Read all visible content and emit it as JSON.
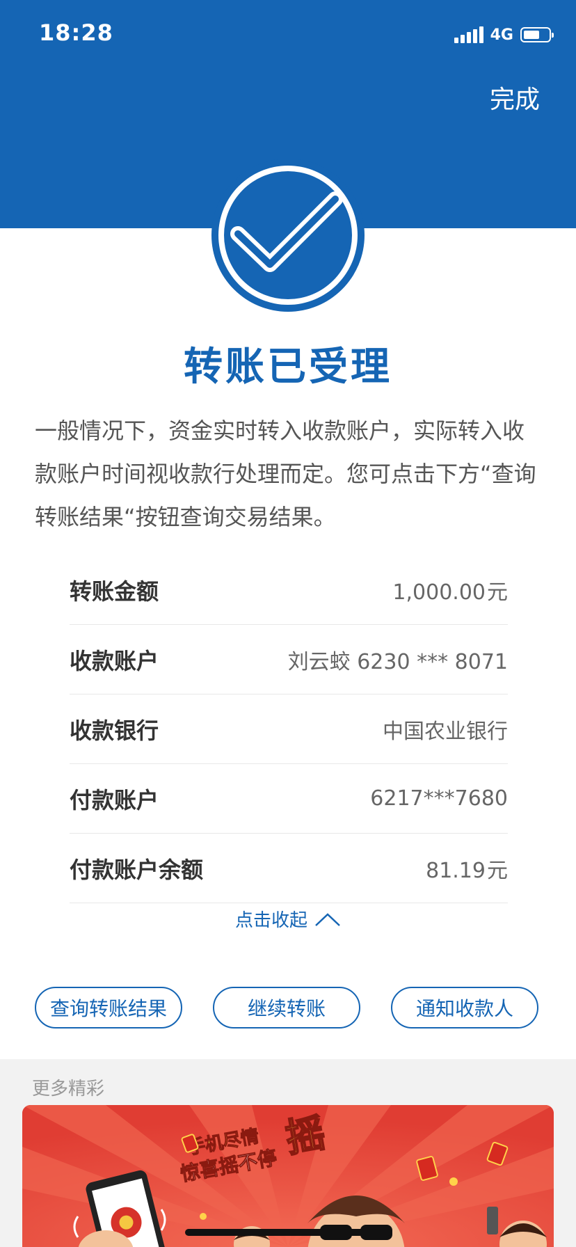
{
  "status_bar": {
    "time": "18:28",
    "network": "4G"
  },
  "header": {
    "done_label": "完成"
  },
  "result": {
    "title": "转账已受理",
    "description": "一般情况下，资金实时转入收款账户，实际转入收款账户时间视收款行处理而定。您可点击下方“查询转账结果“按钮查询交易结果。"
  },
  "details": [
    {
      "label": "转账金额",
      "value": "1,000.00",
      "unit": "元"
    },
    {
      "label": "收款账户",
      "value": "刘云蛟 6230 *** 8071",
      "unit": ""
    },
    {
      "label": "收款银行",
      "value": "中国农业银行",
      "unit": ""
    },
    {
      "label": "付款账户",
      "value": "6217***7680",
      "unit": ""
    },
    {
      "label": "付款账户余额",
      "value": "81.19",
      "unit": "元"
    }
  ],
  "collapse_label": "点击收起",
  "actions": {
    "query": "查询转账结果",
    "continue": "继续转账",
    "notify": "通知收款人"
  },
  "more": {
    "title": "更多精彩",
    "banner_text_line1": "手机尽情",
    "banner_text_line2": "惊喜摇不停",
    "banner_text_big": "摇"
  },
  "colors": {
    "brand": "#1565b4",
    "banner_bg": "#e8473b"
  }
}
